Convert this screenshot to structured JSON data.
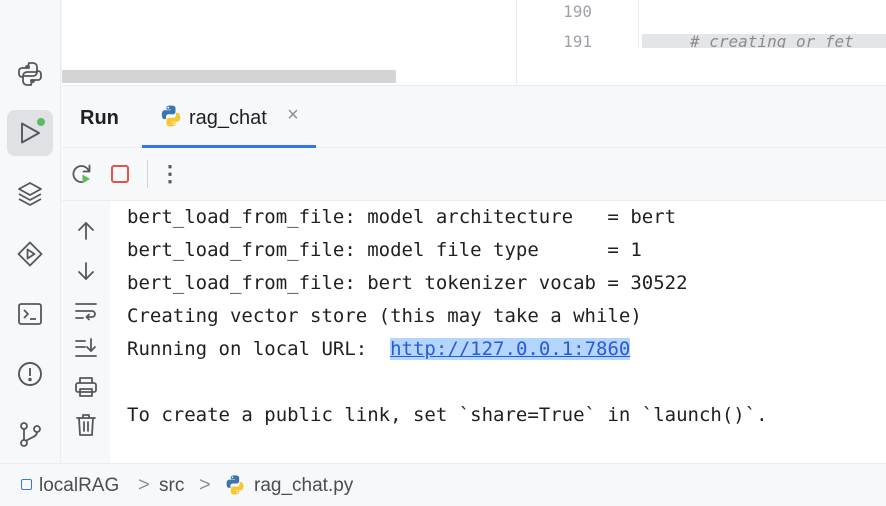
{
  "editor": {
    "line_numbers": [
      "190",
      "191"
    ],
    "comment_text": "# creating or fet"
  },
  "run_panel": {
    "title": "Run",
    "tab": {
      "label": "rag_chat",
      "icon": "python-icon",
      "close_glyph": "×"
    },
    "more_glyph": "⋮"
  },
  "console": {
    "lines": [
      "bert_load_from_file: model architecture   = bert",
      "bert_load_from_file: model file type      = 1",
      "bert_load_from_file: bert tokenizer vocab = 30522",
      "Creating vector store (this may take a while)"
    ],
    "url_prefix": "Running on local URL:  ",
    "url": "http://127.0.0.1:7860",
    "share_hint": "To create a public link, set `share=True` in `launch()`."
  },
  "breadcrumb": {
    "project": "localRAG",
    "folder": "src",
    "file": "rag_chat.py",
    "separator": ">"
  },
  "colors": {
    "accent": "#3574f0",
    "run_indicator": "#5fb865",
    "stop": "#e5534b",
    "link": "#2a5bd7",
    "link_highlight": "#b4d5fe"
  }
}
